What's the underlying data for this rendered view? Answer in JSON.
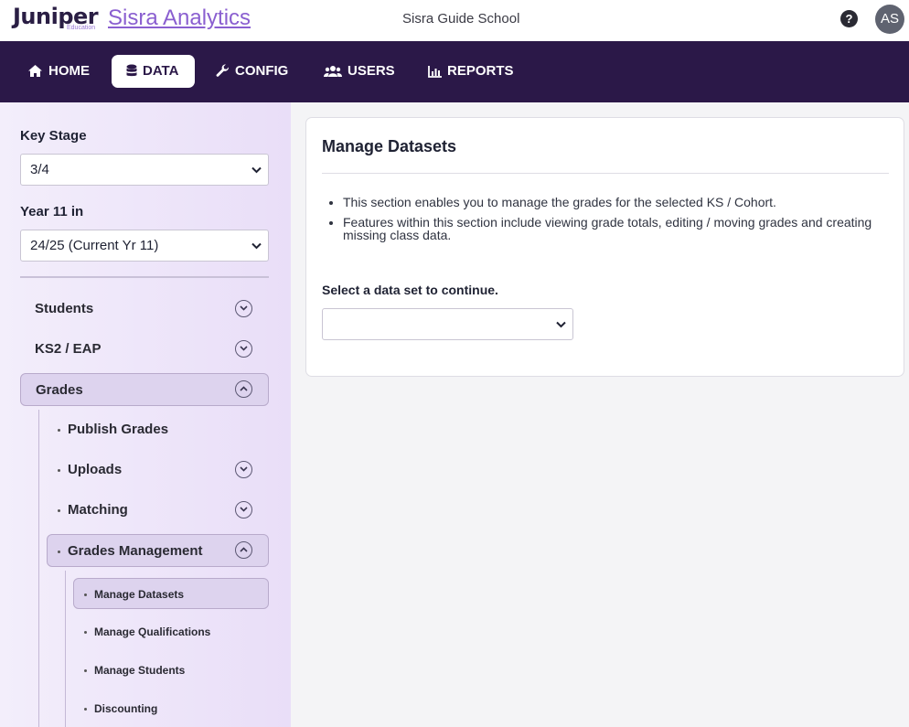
{
  "header": {
    "logo_text": "Juniper",
    "logo_sub": "Education",
    "product_name": "Sisra Analytics",
    "school_name": "Sisra Guide School",
    "help_glyph": "?",
    "avatar_initials": "AS"
  },
  "nav": {
    "items": [
      {
        "label": "HOME",
        "icon": "home-icon"
      },
      {
        "label": "DATA",
        "icon": "database-icon",
        "active": true
      },
      {
        "label": "CONFIG",
        "icon": "wrench-icon"
      },
      {
        "label": "USERS",
        "icon": "users-icon"
      },
      {
        "label": "REPORTS",
        "icon": "bar-chart-icon"
      }
    ]
  },
  "sidebar": {
    "key_stage_label": "Key Stage",
    "key_stage_value": "3/4",
    "year_label": "Year 11 in",
    "year_value": "24/25 (Current Yr 11)",
    "menu": [
      {
        "label": "Students",
        "expanded": false
      },
      {
        "label": "KS2 / EAP",
        "expanded": false
      },
      {
        "label": "Grades",
        "expanded": true
      }
    ],
    "grades_sub": [
      {
        "label": "Publish Grades"
      },
      {
        "label": "Uploads",
        "expanded": false
      },
      {
        "label": "Matching",
        "expanded": false
      },
      {
        "label": "Grades Management",
        "expanded": true
      }
    ],
    "management_sub": [
      {
        "label": "Manage Datasets",
        "active": true
      },
      {
        "label": "Manage Qualifications"
      },
      {
        "label": "Manage Students"
      },
      {
        "label": "Discounting"
      }
    ]
  },
  "main": {
    "title": "Manage Datasets",
    "bullets": [
      "This section enables you to manage the grades for the selected KS / Cohort.",
      "Features within this section include viewing grade totals, editing / moving grades and creating missing class data."
    ],
    "prompt": "Select a data set to continue.",
    "dataset_value": ""
  },
  "colors": {
    "nav_bg": "#2b1848",
    "brand_purple": "#8a5fd0",
    "sidebar_active": "#ddd3ee"
  }
}
